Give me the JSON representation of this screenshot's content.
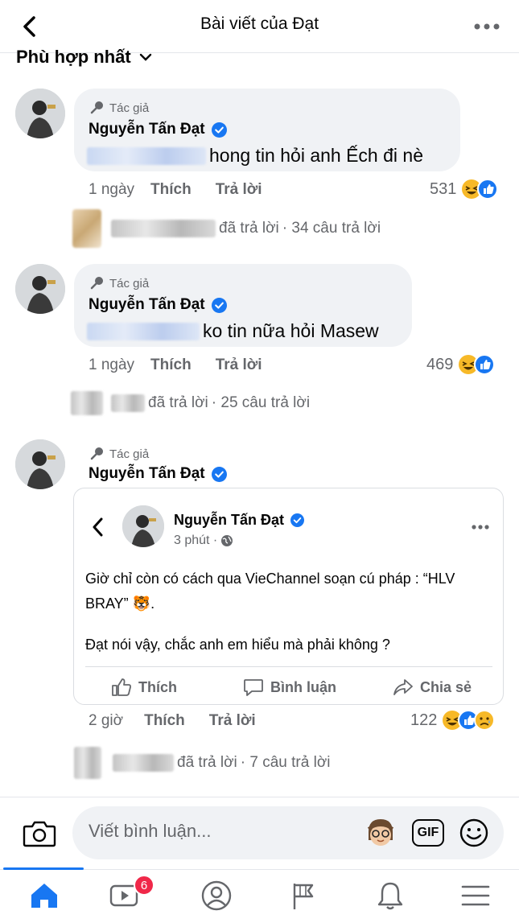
{
  "header": {
    "title": "Bài viết của Đạt"
  },
  "sort": {
    "label": "Phù hợp nhất"
  },
  "comments": [
    {
      "author_tag": "Tác giả",
      "name": "Nguyễn Tấn Đạt",
      "text": "hong tin hỏi anh Ếch đi nè",
      "time": "1 ngày",
      "like": "Thích",
      "reply": "Trả lời",
      "reaction_count": "531",
      "replies_label": "đã trả lời",
      "replies_count": "· 34 câu trả lời"
    },
    {
      "author_tag": "Tác giả",
      "name": "Nguyễn Tấn Đạt",
      "text": "ko tin nữa hỏi Masew",
      "time": "1 ngày",
      "like": "Thích",
      "reply": "Trả lời",
      "reaction_count": "469",
      "replies_label": "đã trả lời",
      "replies_count": "· 25 câu trả lời"
    },
    {
      "author_tag": "Tác giả",
      "name": "Nguyễn Tấn Đạt",
      "time": "2 giờ",
      "like": "Thích",
      "reply": "Trả lời",
      "reaction_count": "122",
      "replies_label": "đã trả lời",
      "replies_count": "· 7 câu trả lời"
    }
  ],
  "shared_post": {
    "name": "Nguyễn Tấn Đạt",
    "time": "3 phút ·",
    "line1": "Giờ chỉ còn có cách qua VieChannel soạn cú pháp : “HLV",
    "line2": "BRAY” 🐯.",
    "line3": "Đạt nói vậy, chắc anh em hiểu mà phải không ?",
    "like": "Thích",
    "comment": "Bình luận",
    "share": "Chia sẻ"
  },
  "composer": {
    "placeholder": "Viết bình luận...",
    "gif": "GIF"
  },
  "nav": {
    "video_badge": "6"
  },
  "colors": {
    "accent": "#1877f2",
    "haha": "#f7b928",
    "like": "#1877f2",
    "badge": "#f02849"
  }
}
